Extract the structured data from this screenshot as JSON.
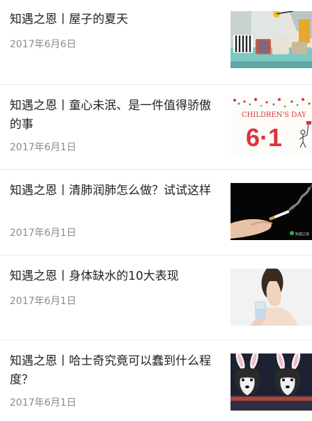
{
  "articles": [
    {
      "title": "知遇之恩丨屋子的夏天",
      "date": "2017年6月6日",
      "thumbnail": "living-room-sofa-image"
    },
    {
      "title": "知遇之恩丨童心未泯、是一件值得骄傲的事",
      "date": "2017年6月1日",
      "thumbnail": "childrens-day-banner-image",
      "thumbnail_text": {
        "heading": "CHILDREN'S DAY",
        "number": "6·1"
      }
    },
    {
      "title": "知遇之恩丨清肺润肺怎么做？试试这样",
      "date": "2017年6月1日",
      "thumbnail": "hand-cigarette-smoke-image",
      "thumbnail_text": {
        "watermark": "知遇之恩"
      }
    },
    {
      "title": "知遇之恩丨身体缺水的10大表现",
      "date": "2017年6月1日",
      "thumbnail": "woman-drinking-water-image"
    },
    {
      "title": "知遇之恩丨哈士奇究竟可以蠢到什么程度？",
      "date": "2017年6月1日",
      "thumbnail": "huskies-bunny-ears-image"
    }
  ]
}
